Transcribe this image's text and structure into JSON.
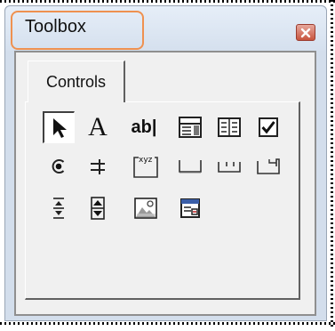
{
  "window": {
    "title": "Toolbox"
  },
  "tabs": [
    {
      "label": "Controls"
    }
  ],
  "controls": [
    {
      "icon": "select-objects-icon"
    },
    {
      "icon": "label-icon",
      "glyph": "A"
    },
    {
      "icon": "textbox-icon",
      "glyph": "ab|"
    },
    {
      "icon": "combobox-icon"
    },
    {
      "icon": "listbox-icon"
    },
    {
      "icon": "checkbox-icon"
    },
    {
      "icon": "optionbutton-icon"
    },
    {
      "icon": "togglebutton-icon"
    },
    {
      "icon": "frame-icon",
      "glyph": "xyz"
    },
    {
      "icon": "commandbutton-icon"
    },
    {
      "icon": "tabstrip-icon"
    },
    {
      "icon": "multipage-icon"
    },
    {
      "icon": "scrollbar-icon"
    },
    {
      "icon": "spinbutton-icon"
    },
    {
      "icon": "image-icon"
    },
    {
      "icon": "refedit-icon"
    }
  ]
}
